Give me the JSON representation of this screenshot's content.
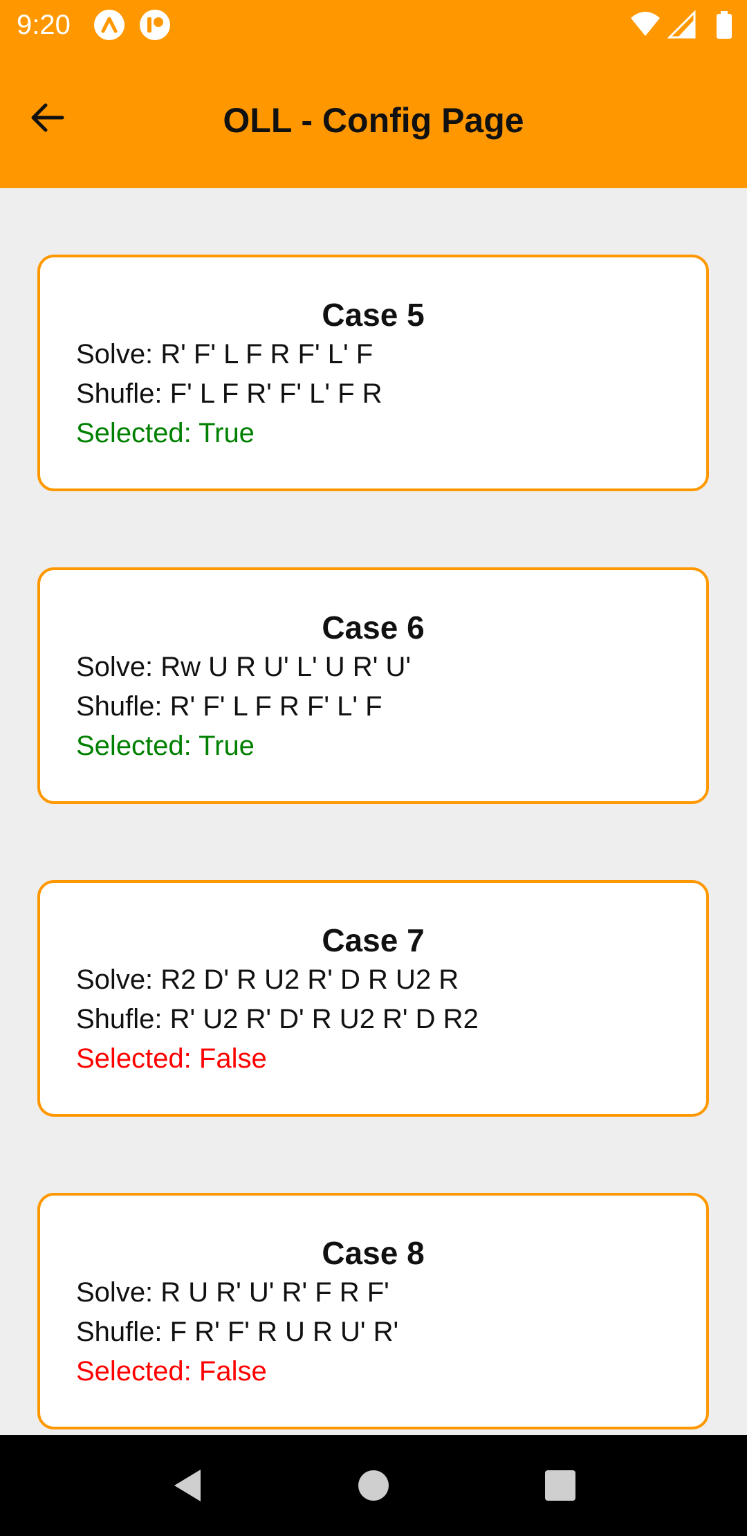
{
  "status_bar": {
    "time": "9:20",
    "icons": [
      "notification-app-icon",
      "notification-app-icon",
      "wifi-icon",
      "cell-signal-icon",
      "battery-icon"
    ]
  },
  "app_bar": {
    "title": "OLL - Config Page",
    "back_icon": "arrow-left-icon"
  },
  "colors": {
    "accent": "#ff9800",
    "selected_true": "#008000",
    "selected_false": "#ff0000",
    "background": "#eeeeee"
  },
  "cases": [
    {
      "title": "Case 5",
      "solve": "Solve: R' F' L F R F' L' F",
      "shuffle": "Shufle: F' L F R' F' L' F R",
      "selected": "Selected: True",
      "is_selected": true
    },
    {
      "title": "Case 6",
      "solve": "Solve: Rw U R U' L' U R' U'",
      "shuffle": "Shufle: R' F' L F R F' L' F",
      "selected": "Selected: True",
      "is_selected": true
    },
    {
      "title": "Case 7",
      "solve": "Solve: R2 D' R U2 R' D R U2 R",
      "shuffle": "Shufle: R' U2 R' D' R U2 R' D R2",
      "selected": "Selected: False",
      "is_selected": false
    },
    {
      "title": "Case 8",
      "solve": "Solve: R U R' U' R' F R F'",
      "shuffle": "Shufle: F R' F' R U R U' R'",
      "selected": "Selected: False",
      "is_selected": false
    }
  ],
  "nav_bar": {
    "buttons": [
      "back-triangle-icon",
      "home-circle-icon",
      "recents-square-icon"
    ]
  }
}
